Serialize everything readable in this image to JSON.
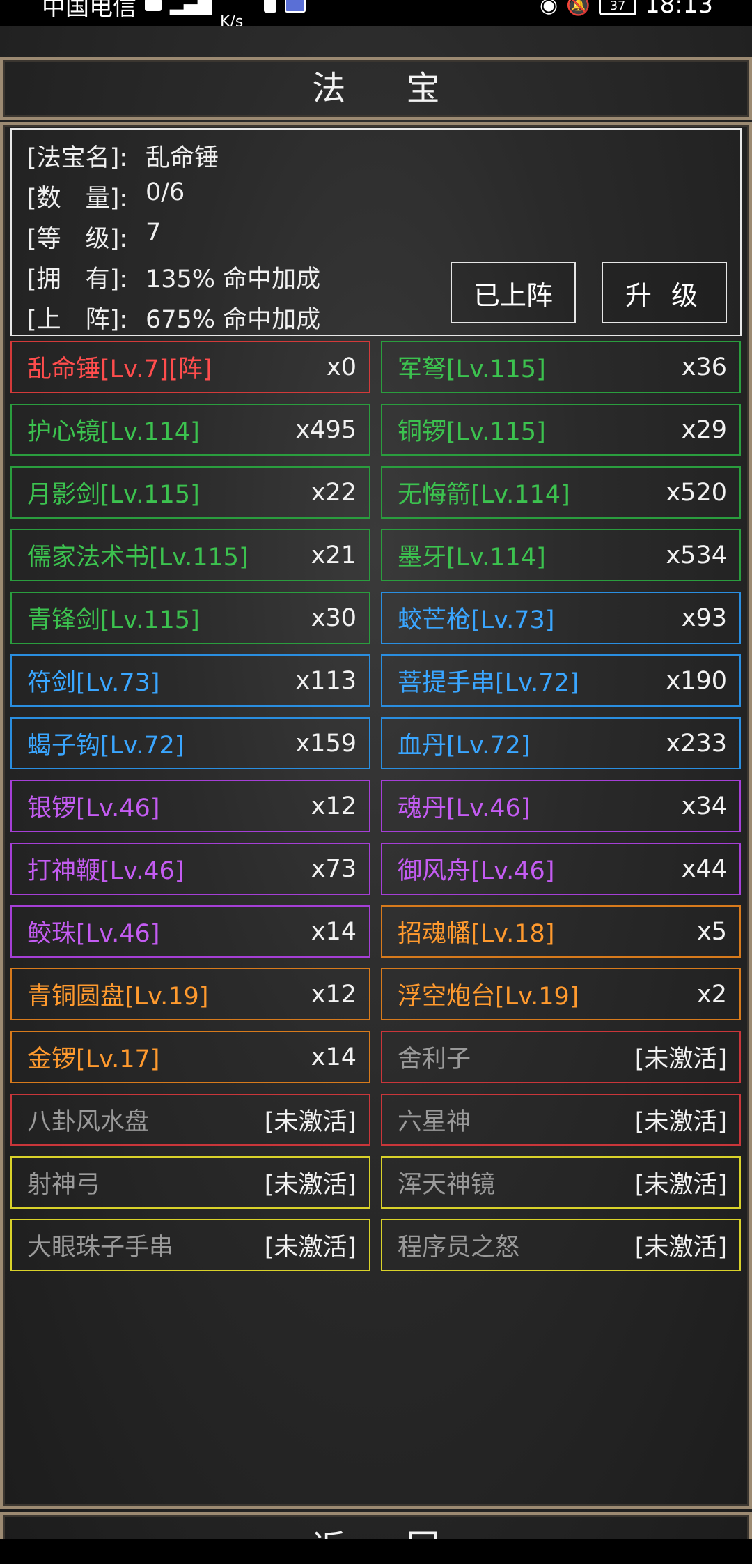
{
  "statusbar": {
    "carrier": "中国电信",
    "speed": "K/s",
    "time": "18:13",
    "battery": "37"
  },
  "title": "法 宝",
  "info": {
    "name_key": "[法宝名]:",
    "name_val": "乱命锤",
    "qty_key": "[数　量]:",
    "qty_val": "0/6",
    "level_key": "[等　级]:",
    "level_val": "7",
    "own_key": "[拥　有]:",
    "own_val": "135% 命中加成",
    "deploy_key": "[上　阵]:",
    "deploy_val": "675% 命中加成"
  },
  "buttons": {
    "deployed": "已上阵",
    "upgrade": "升 级"
  },
  "items": [
    {
      "name": "乱命锤[Lv.7][阵]",
      "count": "x0",
      "tier": "red"
    },
    {
      "name": "军弩[Lv.115]",
      "count": "x36",
      "tier": "green"
    },
    {
      "name": "护心镜[Lv.114]",
      "count": "x495",
      "tier": "green"
    },
    {
      "name": "铜锣[Lv.115]",
      "count": "x29",
      "tier": "green"
    },
    {
      "name": "月影剑[Lv.115]",
      "count": "x22",
      "tier": "green"
    },
    {
      "name": "无悔箭[Lv.114]",
      "count": "x520",
      "tier": "green"
    },
    {
      "name": "儒家法术书[Lv.115]",
      "count": "x21",
      "tier": "green"
    },
    {
      "name": "墨牙[Lv.114]",
      "count": "x534",
      "tier": "green"
    },
    {
      "name": "青锋剑[Lv.115]",
      "count": "x30",
      "tier": "green"
    },
    {
      "name": "蛟芒枪[Lv.73]",
      "count": "x93",
      "tier": "blue"
    },
    {
      "name": "符剑[Lv.73]",
      "count": "x113",
      "tier": "blue"
    },
    {
      "name": "菩提手串[Lv.72]",
      "count": "x190",
      "tier": "blue"
    },
    {
      "name": "蝎子钩[Lv.72]",
      "count": "x159",
      "tier": "blue"
    },
    {
      "name": "血丹[Lv.72]",
      "count": "x233",
      "tier": "blue"
    },
    {
      "name": "银锣[Lv.46]",
      "count": "x12",
      "tier": "purple"
    },
    {
      "name": "魂丹[Lv.46]",
      "count": "x34",
      "tier": "purple"
    },
    {
      "name": "打神鞭[Lv.46]",
      "count": "x73",
      "tier": "purple"
    },
    {
      "name": "御风舟[Lv.46]",
      "count": "x44",
      "tier": "purple"
    },
    {
      "name": "鲛珠[Lv.46]",
      "count": "x14",
      "tier": "purple"
    },
    {
      "name": "招魂幡[Lv.18]",
      "count": "x5",
      "tier": "orange"
    },
    {
      "name": "青铜圆盘[Lv.19]",
      "count": "x12",
      "tier": "orange"
    },
    {
      "name": "浮空炮台[Lv.19]",
      "count": "x2",
      "tier": "orange"
    },
    {
      "name": "金锣[Lv.17]",
      "count": "x14",
      "tier": "orange"
    },
    {
      "name": "舍利子",
      "count": "[未激活]",
      "tier": "gray-red"
    },
    {
      "name": "八卦风水盘",
      "count": "[未激活]",
      "tier": "gray-red"
    },
    {
      "name": "六星神",
      "count": "[未激活]",
      "tier": "gray-red"
    },
    {
      "name": "射神弓",
      "count": "[未激活]",
      "tier": "gray-yellow"
    },
    {
      "name": "浑天神镜",
      "count": "[未激活]",
      "tier": "gray-yellow"
    },
    {
      "name": "大眼珠子手串",
      "count": "[未激活]",
      "tier": "gray-yellow"
    },
    {
      "name": "程序员之怒",
      "count": "[未激活]",
      "tier": "gray-yellow"
    }
  ],
  "back": "返 回"
}
